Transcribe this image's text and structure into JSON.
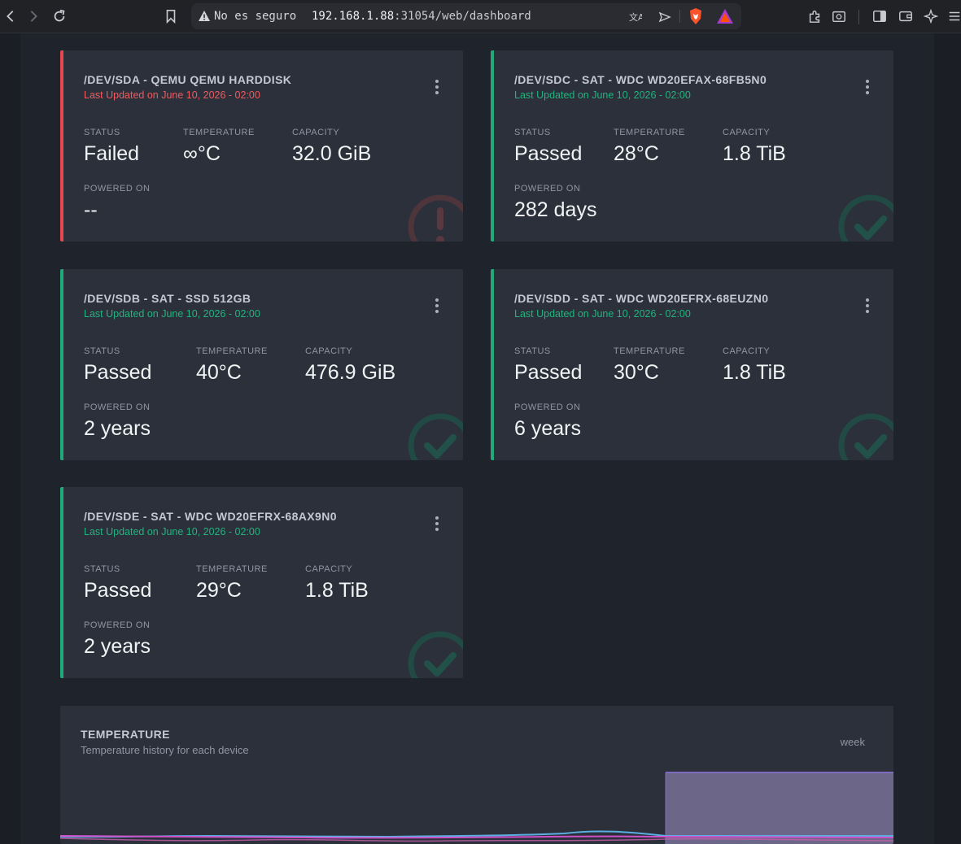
{
  "browser": {
    "security_label": "No es seguro",
    "url_host": "192.168.1.88",
    "url_rest": ":31054/web/dashboard"
  },
  "devices": [
    {
      "title": "/DEV/SDA - QEMU QEMU HARDDISK",
      "updated": "Last Updated on June 10, 2026 - 02:00",
      "status_label": "STATUS",
      "status": "Failed",
      "temp_label": "TEMPERATURE",
      "temp": "∞°C",
      "capacity_label": "CAPACITY",
      "capacity": "32.0 GiB",
      "powered_label": "POWERED ON",
      "powered": "--",
      "state": "failed"
    },
    {
      "title": "/DEV/SDC - SAT - WDC WD20EFAX-68FB5N0",
      "updated": "Last Updated on June 10, 2026 - 02:00",
      "status_label": "STATUS",
      "status": "Passed",
      "temp_label": "TEMPERATURE",
      "temp": "28°C",
      "capacity_label": "CAPACITY",
      "capacity": "1.8 TiB",
      "powered_label": "POWERED ON",
      "powered": "282 days",
      "state": "passed"
    },
    {
      "title": "/DEV/SDB - SAT - SSD 512GB",
      "updated": "Last Updated on June 10, 2026 - 02:00",
      "status_label": "STATUS",
      "status": "Passed",
      "temp_label": "TEMPERATURE",
      "temp": "40°C",
      "capacity_label": "CAPACITY",
      "capacity": "476.9 GiB",
      "powered_label": "POWERED ON",
      "powered": "2 years",
      "state": "passed"
    },
    {
      "title": "/DEV/SDD - SAT - WDC WD20EFRX-68EUZN0",
      "updated": "Last Updated on June 10, 2026 - 02:00",
      "status_label": "STATUS",
      "status": "Passed",
      "temp_label": "TEMPERATURE",
      "temp": "30°C",
      "capacity_label": "CAPACITY",
      "capacity": "1.8 TiB",
      "powered_label": "POWERED ON",
      "powered": "6 years",
      "state": "passed"
    },
    {
      "title": "/DEV/SDE - SAT - WDC WD20EFRX-68AX9N0",
      "updated": "Last Updated on June 10, 2026 - 02:00",
      "status_label": "STATUS",
      "status": "Passed",
      "temp_label": "TEMPERATURE",
      "temp": "29°C",
      "capacity_label": "CAPACITY",
      "capacity": "1.8 TiB",
      "powered_label": "POWERED ON",
      "powered": "2 years",
      "state": "passed"
    }
  ],
  "temperature": {
    "title": "TEMPERATURE",
    "subtitle": "Temperature history for each device",
    "period": "week"
  },
  "colors": {
    "passed": "#22a879",
    "failed": "#e5484d",
    "card_bg": "#2b303b",
    "page_bg": "#1f232c"
  }
}
